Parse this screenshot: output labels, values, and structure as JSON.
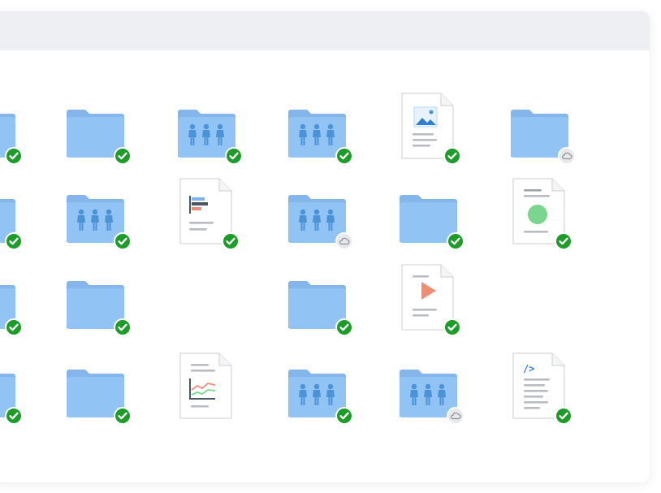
{
  "colors": {
    "folder": "#92c3f5",
    "folder_back": "#84b6ec",
    "people": "#4b93d6",
    "synced_badge": "#1e9c2a",
    "cloud_badge": "#e7e8ea",
    "doc_line": "#b9bcc2"
  },
  "grid": [
    [
      {
        "icon": "folder-icon",
        "status": "synced"
      },
      {
        "icon": "folder-icon",
        "status": "synced"
      },
      {
        "icon": "shared-folder-icon",
        "status": "synced"
      },
      {
        "icon": "shared-folder-icon",
        "status": "synced"
      },
      {
        "icon": "image-file-icon",
        "status": "synced"
      },
      {
        "icon": "folder-icon",
        "status": "cloud"
      }
    ],
    [
      {
        "icon": "team-folder-icon",
        "status": "synced"
      },
      {
        "icon": "shared-folder-icon",
        "status": "synced"
      },
      {
        "icon": "chart-file-icon",
        "status": "synced"
      },
      {
        "icon": "shared-folder-icon",
        "status": "cloud"
      },
      {
        "icon": "folder-icon",
        "status": "synced"
      },
      {
        "icon": "document-file-icon",
        "status": "synced"
      }
    ],
    [
      {
        "icon": "folder-icon",
        "status": "synced"
      },
      {
        "icon": "folder-icon",
        "status": "synced"
      },
      null,
      {
        "icon": "folder-icon",
        "status": "synced"
      },
      {
        "icon": "video-file-icon",
        "status": "synced"
      },
      null
    ],
    [
      {
        "icon": "folder-icon",
        "status": "synced"
      },
      {
        "icon": "folder-icon",
        "status": "synced"
      },
      {
        "icon": "spreadsheet-chart-file-icon",
        "status": "none"
      },
      {
        "icon": "shared-folder-icon",
        "status": "synced"
      },
      {
        "icon": "shared-folder-icon",
        "status": "cloud"
      },
      {
        "icon": "code-file-icon",
        "status": "synced"
      }
    ]
  ]
}
